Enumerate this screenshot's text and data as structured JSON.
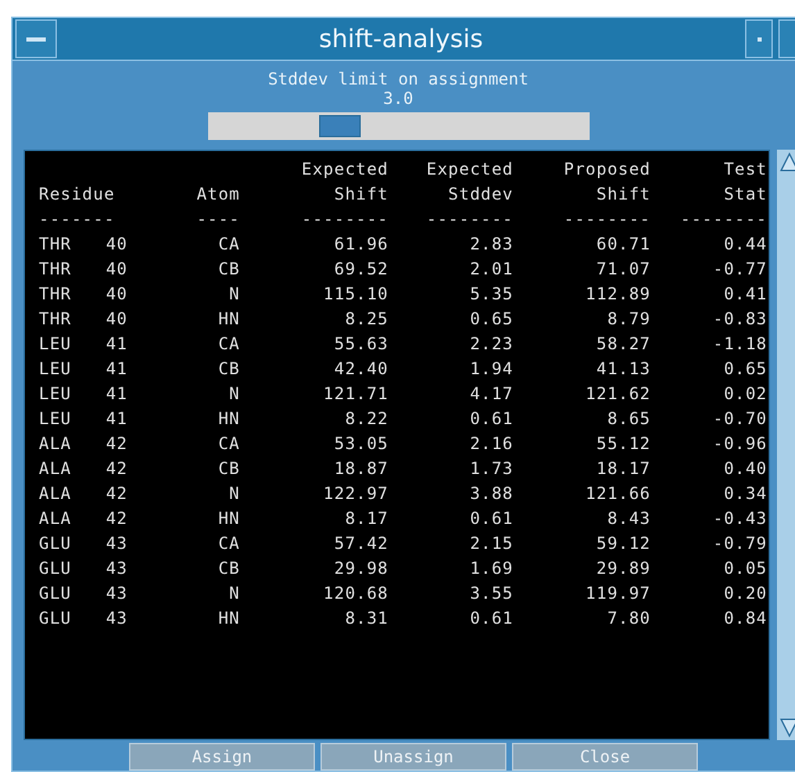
{
  "window": {
    "title": "shift-analysis"
  },
  "slider": {
    "label": "Stddev limit on assignment",
    "value": "3.0",
    "level": 0.33
  },
  "table": {
    "columns": [
      {
        "line2": "Residue",
        "underline": "-------"
      },
      {
        "line2": "Atom",
        "underline": "----"
      },
      {
        "line1": "Expected",
        "line2": "Shift",
        "underline": "--------"
      },
      {
        "line1": "Expected",
        "line2": "Stddev",
        "underline": "--------"
      },
      {
        "line1": "Proposed",
        "line2": "Shift",
        "underline": "--------"
      },
      {
        "line1": "Test",
        "line2": "Stat",
        "underline": "--------"
      }
    ],
    "rows": [
      {
        "residue": "THR",
        "number": "40",
        "atom": "CA",
        "expected_shift": "61.96",
        "expected_stddev": "2.83",
        "proposed_shift": "60.71",
        "test_stat": "0.44"
      },
      {
        "residue": "THR",
        "number": "40",
        "atom": "CB",
        "expected_shift": "69.52",
        "expected_stddev": "2.01",
        "proposed_shift": "71.07",
        "test_stat": "-0.77"
      },
      {
        "residue": "THR",
        "number": "40",
        "atom": "N",
        "expected_shift": "115.10",
        "expected_stddev": "5.35",
        "proposed_shift": "112.89",
        "test_stat": "0.41"
      },
      {
        "residue": "THR",
        "number": "40",
        "atom": "HN",
        "expected_shift": "8.25",
        "expected_stddev": "0.65",
        "proposed_shift": "8.79",
        "test_stat": "-0.83"
      },
      {
        "residue": "LEU",
        "number": "41",
        "atom": "CA",
        "expected_shift": "55.63",
        "expected_stddev": "2.23",
        "proposed_shift": "58.27",
        "test_stat": "-1.18"
      },
      {
        "residue": "LEU",
        "number": "41",
        "atom": "CB",
        "expected_shift": "42.40",
        "expected_stddev": "1.94",
        "proposed_shift": "41.13",
        "test_stat": "0.65"
      },
      {
        "residue": "LEU",
        "number": "41",
        "atom": "N",
        "expected_shift": "121.71",
        "expected_stddev": "4.17",
        "proposed_shift": "121.62",
        "test_stat": "0.02"
      },
      {
        "residue": "LEU",
        "number": "41",
        "atom": "HN",
        "expected_shift": "8.22",
        "expected_stddev": "0.61",
        "proposed_shift": "8.65",
        "test_stat": "-0.70"
      },
      {
        "residue": "ALA",
        "number": "42",
        "atom": "CA",
        "expected_shift": "53.05",
        "expected_stddev": "2.16",
        "proposed_shift": "55.12",
        "test_stat": "-0.96"
      },
      {
        "residue": "ALA",
        "number": "42",
        "atom": "CB",
        "expected_shift": "18.87",
        "expected_stddev": "1.73",
        "proposed_shift": "18.17",
        "test_stat": "0.40"
      },
      {
        "residue": "ALA",
        "number": "42",
        "atom": "N",
        "expected_shift": "122.97",
        "expected_stddev": "3.88",
        "proposed_shift": "121.66",
        "test_stat": "0.34"
      },
      {
        "residue": "ALA",
        "number": "42",
        "atom": "HN",
        "expected_shift": "8.17",
        "expected_stddev": "0.61",
        "proposed_shift": "8.43",
        "test_stat": "-0.43"
      },
      {
        "residue": "GLU",
        "number": "43",
        "atom": "CA",
        "expected_shift": "57.42",
        "expected_stddev": "2.15",
        "proposed_shift": "59.12",
        "test_stat": "-0.79"
      },
      {
        "residue": "GLU",
        "number": "43",
        "atom": "CB",
        "expected_shift": "29.98",
        "expected_stddev": "1.69",
        "proposed_shift": "29.89",
        "test_stat": "0.05"
      },
      {
        "residue": "GLU",
        "number": "43",
        "atom": "N",
        "expected_shift": "120.68",
        "expected_stddev": "3.55",
        "proposed_shift": "119.97",
        "test_stat": "0.20"
      },
      {
        "residue": "GLU",
        "number": "43",
        "atom": "HN",
        "expected_shift": "8.31",
        "expected_stddev": "0.61",
        "proposed_shift": "7.80",
        "test_stat": "0.84"
      }
    ]
  },
  "buttons": [
    "Assign",
    "Unassign",
    "Close"
  ]
}
